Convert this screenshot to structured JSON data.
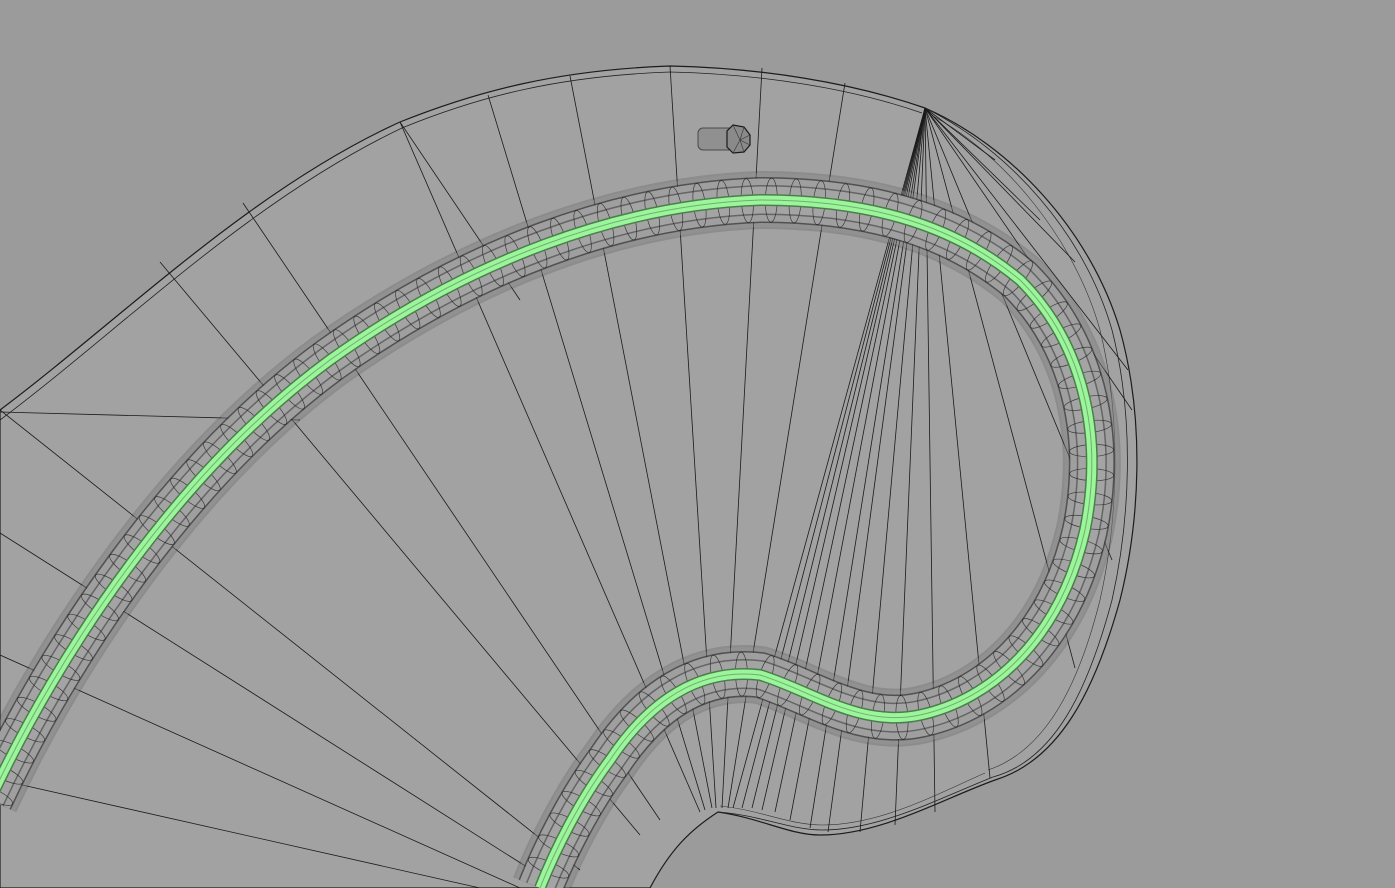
{
  "viewport": {
    "background_color": "#9b9b9b",
    "wire_color": "#1a1a1a",
    "highlight_color": "#9bf59b",
    "highlight_outline": "#5e9e5e",
    "objects": {
      "stair_mesh": "spiral-stair-wireframe",
      "rail_curve": "handrail-tube-selected",
      "light": "cylinder-light-object"
    }
  }
}
